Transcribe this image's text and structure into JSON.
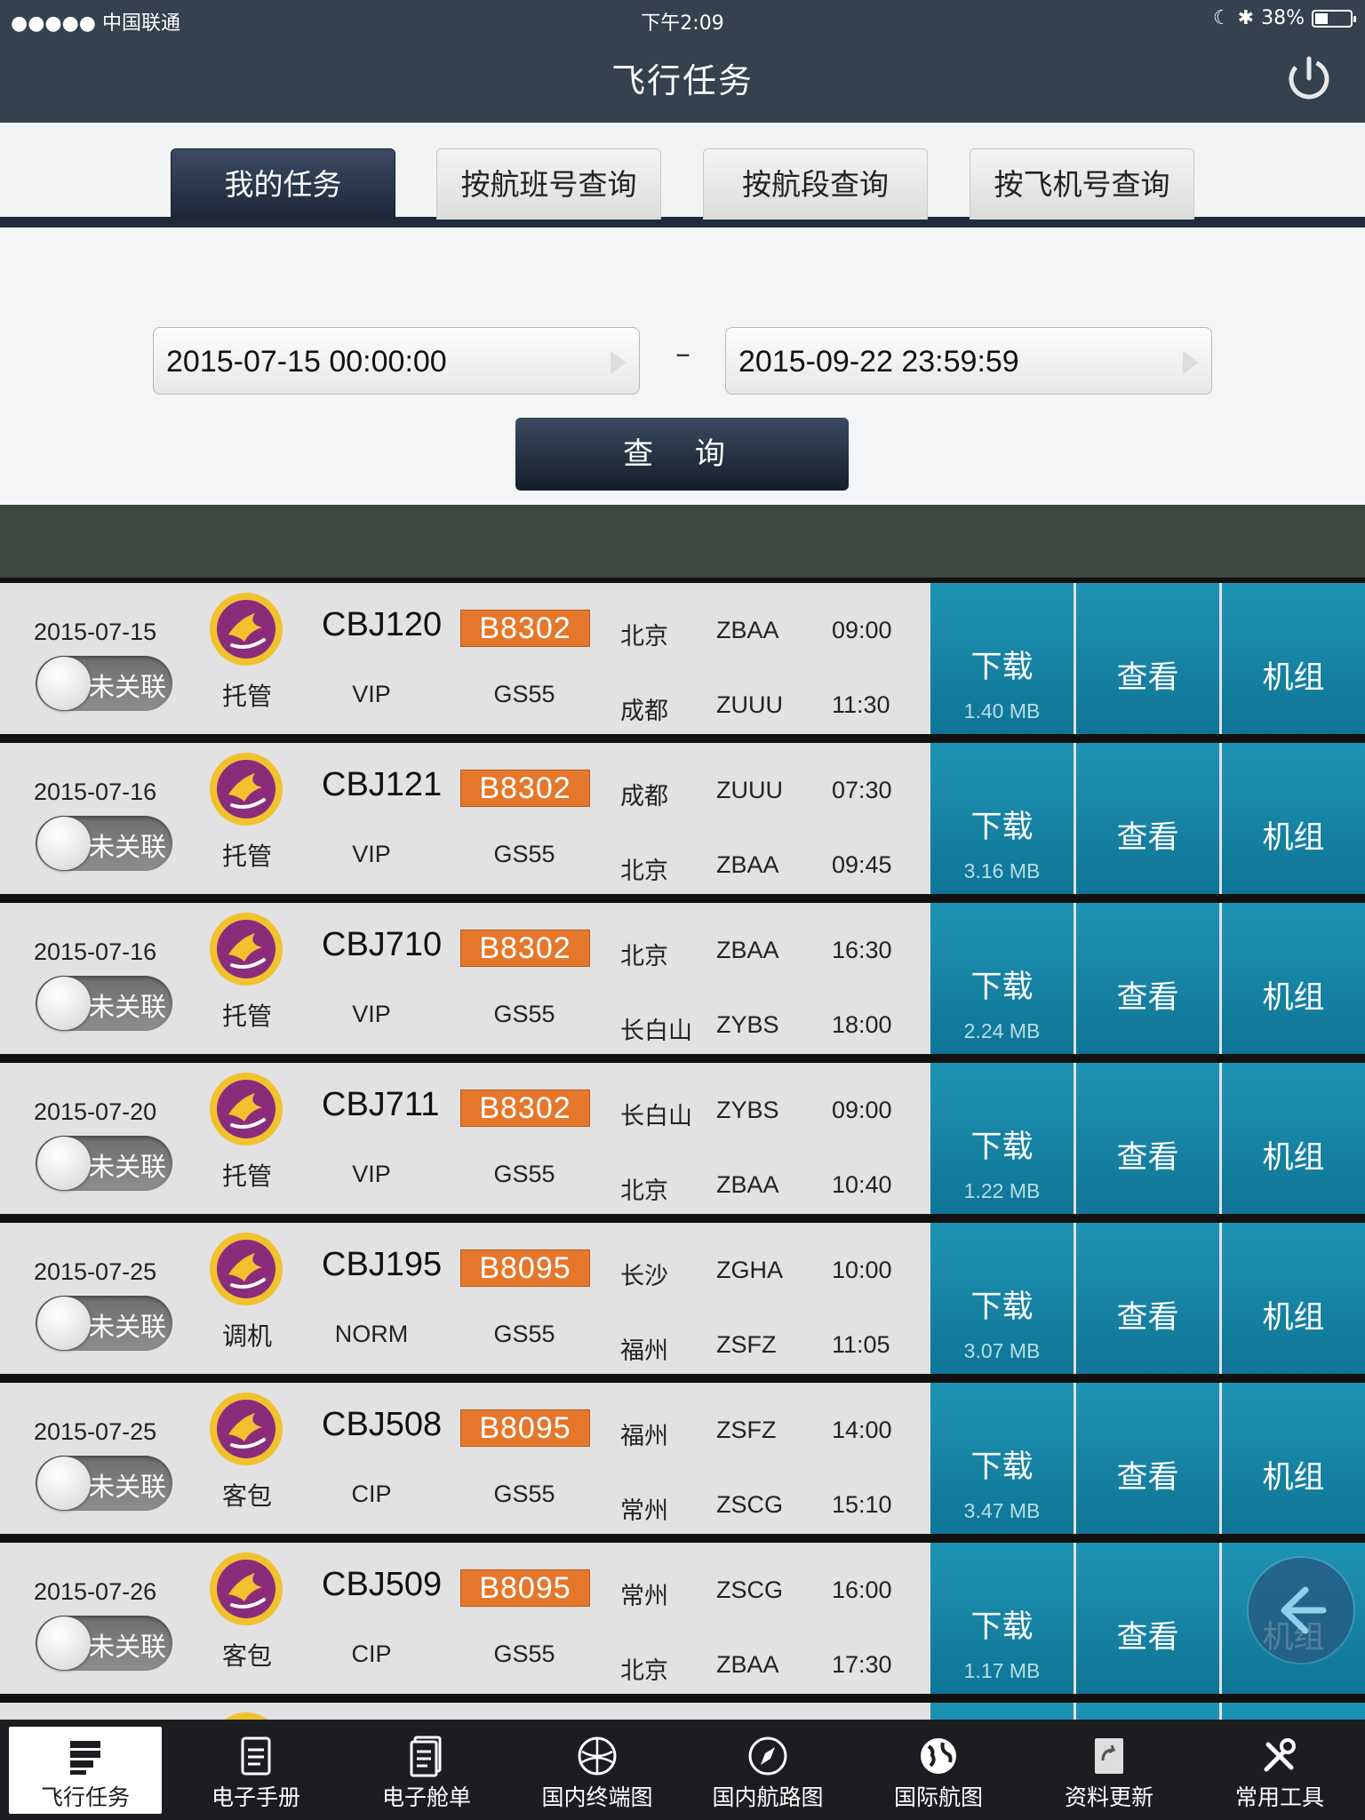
{
  "status_bar": {
    "carrier": "●●●●● 中国联通",
    "time": "下午2:09",
    "battery": "38%",
    "battery_level": 0.38
  },
  "header": {
    "title": "飞行任务"
  },
  "tabs": [
    {
      "label": "我的任务",
      "active": true
    },
    {
      "label": "按航班号查询",
      "active": false
    },
    {
      "label": "按航段查询",
      "active": false
    },
    {
      "label": "按飞机号查询",
      "active": false
    }
  ],
  "search": {
    "start": "2015-07-15 00:00:00",
    "separator": "–",
    "end": "2015-09-22 23:59:59",
    "button": "查 询"
  },
  "actions": {
    "download": "下载",
    "view": "查看",
    "crew": "机组"
  },
  "toggle_label": "未关联",
  "flights": [
    {
      "date": "2015-07-15",
      "type": "托管",
      "flight": "CBJ120",
      "reg": "B8302",
      "class": "VIP",
      "aircraft": "GS55",
      "dep_city": "北京",
      "dep_icao": "ZBAA",
      "dep_time": "09:00",
      "arr_city": "成都",
      "arr_icao": "ZUUU",
      "arr_time": "11:30",
      "size": "1.40 MB"
    },
    {
      "date": "2015-07-16",
      "type": "托管",
      "flight": "CBJ121",
      "reg": "B8302",
      "class": "VIP",
      "aircraft": "GS55",
      "dep_city": "成都",
      "dep_icao": "ZUUU",
      "dep_time": "07:30",
      "arr_city": "北京",
      "arr_icao": "ZBAA",
      "arr_time": "09:45",
      "size": "3.16 MB"
    },
    {
      "date": "2015-07-16",
      "type": "托管",
      "flight": "CBJ710",
      "reg": "B8302",
      "class": "VIP",
      "aircraft": "GS55",
      "dep_city": "北京",
      "dep_icao": "ZBAA",
      "dep_time": "16:30",
      "arr_city": "长白山",
      "arr_icao": "ZYBS",
      "arr_time": "18:00",
      "size": "2.24 MB"
    },
    {
      "date": "2015-07-20",
      "type": "托管",
      "flight": "CBJ711",
      "reg": "B8302",
      "class": "VIP",
      "aircraft": "GS55",
      "dep_city": "长白山",
      "dep_icao": "ZYBS",
      "dep_time": "09:00",
      "arr_city": "北京",
      "arr_icao": "ZBAA",
      "arr_time": "10:40",
      "size": "1.22 MB"
    },
    {
      "date": "2015-07-25",
      "type": "调机",
      "flight": "CBJ195",
      "reg": "B8095",
      "class": "NORM",
      "aircraft": "GS55",
      "dep_city": "长沙",
      "dep_icao": "ZGHA",
      "dep_time": "10:00",
      "arr_city": "福州",
      "arr_icao": "ZSFZ",
      "arr_time": "11:05",
      "size": "3.07 MB"
    },
    {
      "date": "2015-07-25",
      "type": "客包",
      "flight": "CBJ508",
      "reg": "B8095",
      "class": "CIP",
      "aircraft": "GS55",
      "dep_city": "福州",
      "dep_icao": "ZSFZ",
      "dep_time": "14:00",
      "arr_city": "常州",
      "arr_icao": "ZSCG",
      "arr_time": "15:10",
      "size": "3.47 MB"
    },
    {
      "date": "2015-07-26",
      "type": "客包",
      "flight": "CBJ509",
      "reg": "B8095",
      "class": "CIP",
      "aircraft": "GS55",
      "dep_city": "常州",
      "dep_icao": "ZSCG",
      "dep_time": "16:00",
      "arr_city": "北京",
      "arr_icao": "ZBAA",
      "arr_time": "17:30",
      "size": "1.17 MB"
    }
  ],
  "tabbar": [
    {
      "label": "飞行任务",
      "icon": "flight-task-icon",
      "active": true
    },
    {
      "label": "电子手册",
      "icon": "manual-icon",
      "active": false
    },
    {
      "label": "电子舱单",
      "icon": "manifest-icon",
      "active": false
    },
    {
      "label": "国内终端图",
      "icon": "terminal-chart-icon",
      "active": false
    },
    {
      "label": "国内航路图",
      "icon": "compass-icon",
      "active": false
    },
    {
      "label": "国际航图",
      "icon": "globe-icon",
      "active": false
    },
    {
      "label": "资料更新",
      "icon": "update-icon",
      "active": false
    },
    {
      "label": "常用工具",
      "icon": "tools-icon",
      "active": false
    }
  ],
  "colors": {
    "header": "#34414e",
    "accent_blue": "#1585a8",
    "registration_orange": "#e5772c",
    "logo_purple": "#8a2c7a",
    "logo_gold": "#f2c12e"
  }
}
